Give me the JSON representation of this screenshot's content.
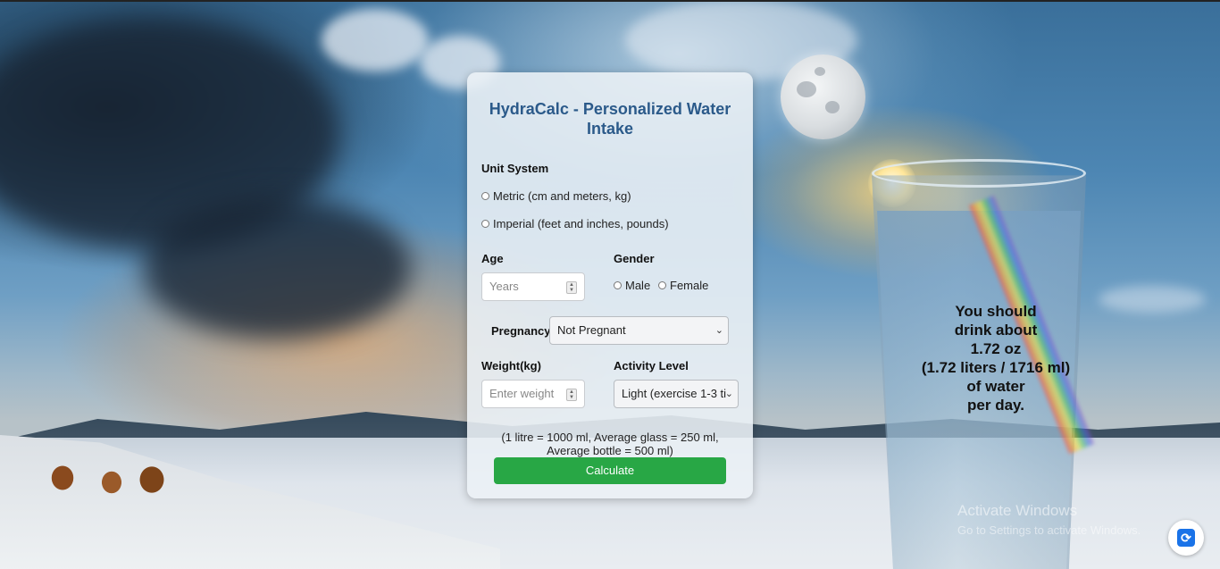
{
  "app": {
    "title": "HydraCalc - Personalized Water Intake"
  },
  "form": {
    "unit_system_label": "Unit System",
    "unit_options": [
      "Metric (cm and meters, kg)",
      "Imperial (feet and inches, pounds)"
    ],
    "age_label": "Age",
    "age_placeholder": "Years",
    "gender_label": "Gender",
    "gender_options": [
      "Male",
      "Female"
    ],
    "pregnancy_label": "Pregnancy",
    "pregnancy_value": "Not Pregnant",
    "weight_label": "Weight(kg)",
    "weight_placeholder": "Enter weight",
    "activity_label": "Activity Level",
    "activity_value": "Light (exercise 1-3 ti",
    "note": "(1 litre = 1000 ml, Average glass = 250 ml, Average bottle = 500 ml)",
    "calculate_label": "Calculate"
  },
  "result": {
    "line1": "You should",
    "line2": "drink about",
    "line3": "1.72 oz",
    "line4": "(1.72 liters / 1716 ml)",
    "line5": "of water",
    "line6": "per day."
  },
  "overlay": {
    "watermark_title": "Activate Windows",
    "watermark_sub": "Go to Settings to activate Windows."
  },
  "icons": {
    "fab_icon": "refresh-icon"
  },
  "colors": {
    "title": "#2b5a8a",
    "calculate_button": "#28a745",
    "fab_accent": "#1a73e8"
  }
}
